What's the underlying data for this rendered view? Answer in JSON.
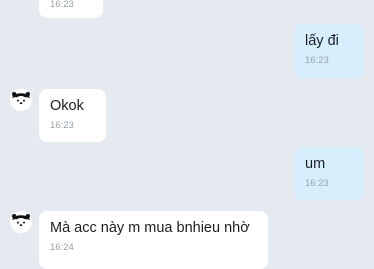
{
  "messages": [
    {
      "direction": "incoming",
      "text": "",
      "time": "16:23",
      "has_avatar": false
    },
    {
      "direction": "outgoing",
      "text": "lấy đi",
      "time": "16:23",
      "has_avatar": false
    },
    {
      "direction": "incoming",
      "text": "Okok",
      "time": "16:23",
      "has_avatar": true
    },
    {
      "direction": "outgoing",
      "text": "um",
      "time": "16:23",
      "has_avatar": false
    },
    {
      "direction": "incoming",
      "text": "Mà acc này m mua bnhieu nhờ",
      "time": "16:24",
      "has_avatar": true
    }
  ],
  "colors": {
    "background": "#e5e9f0",
    "incoming_bubble": "#ffffff",
    "outgoing_bubble": "#d7eefd",
    "message_text": "#1b1f23",
    "timestamp": "#98a1ab"
  },
  "icons": {
    "contact_avatar": "bear-avatar-icon"
  }
}
